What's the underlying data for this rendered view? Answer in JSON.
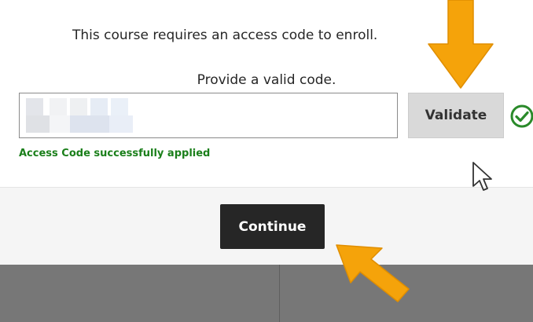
{
  "dialog": {
    "message": "This course requires an access code to enroll.",
    "instruction": "Provide a valid code.",
    "access_code_input": {
      "value": "",
      "placeholder": ""
    },
    "validate_label": "Validate",
    "status_icon": "check-circle-icon",
    "success_message": "Access Code successfully applied",
    "continue_label": "Continue"
  },
  "annotations": {
    "arrow_color": "#f5a30a",
    "arrows": [
      "arrow-to-validate-icon",
      "arrow-to-continue-icon"
    ],
    "cursor_icon": "mouse-pointer-icon"
  },
  "colors": {
    "success": "#1a7f1a",
    "check": "#2a8a2a",
    "continue_bg": "#262626",
    "validate_bg": "#d9d9d9"
  }
}
